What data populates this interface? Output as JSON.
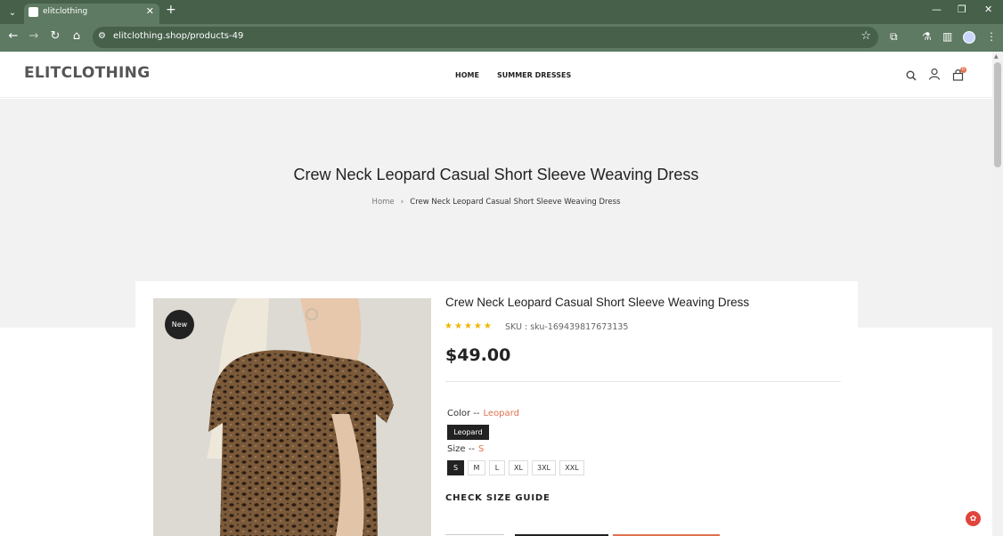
{
  "browser": {
    "tab_title": "elitclothing",
    "url": "elitclothing.shop/products-49",
    "accent": "#5e7a62"
  },
  "site": {
    "logo": "ELITCLOTHING",
    "nav": [
      "HOME",
      "SUMMER DRESSES"
    ],
    "cart_count": "0"
  },
  "banner": {
    "title": "Crew Neck Leopard Casual Short Sleeve Weaving Dress",
    "breadcrumb_home": "Home",
    "breadcrumb_current": "Crew Neck Leopard Casual Short Sleeve Weaving Dress"
  },
  "product": {
    "badge": "New",
    "title": "Crew Neck Leopard Casual Short Sleeve Weaving Dress",
    "rating_stars": 5,
    "sku": "SKU : sku-169439817673135",
    "price": "$49.00",
    "color_label": "Color --",
    "color_value": "Leopard",
    "color_options": [
      "Leopard"
    ],
    "size_label": "Size --",
    "size_value": "S",
    "size_options": [
      "S",
      "M",
      "L",
      "XL",
      "3XL",
      "XXL"
    ],
    "size_guide": "CHECK SIZE GUIDE"
  },
  "colors": {
    "highlight": "#e0714f",
    "star": "#f0b500"
  }
}
